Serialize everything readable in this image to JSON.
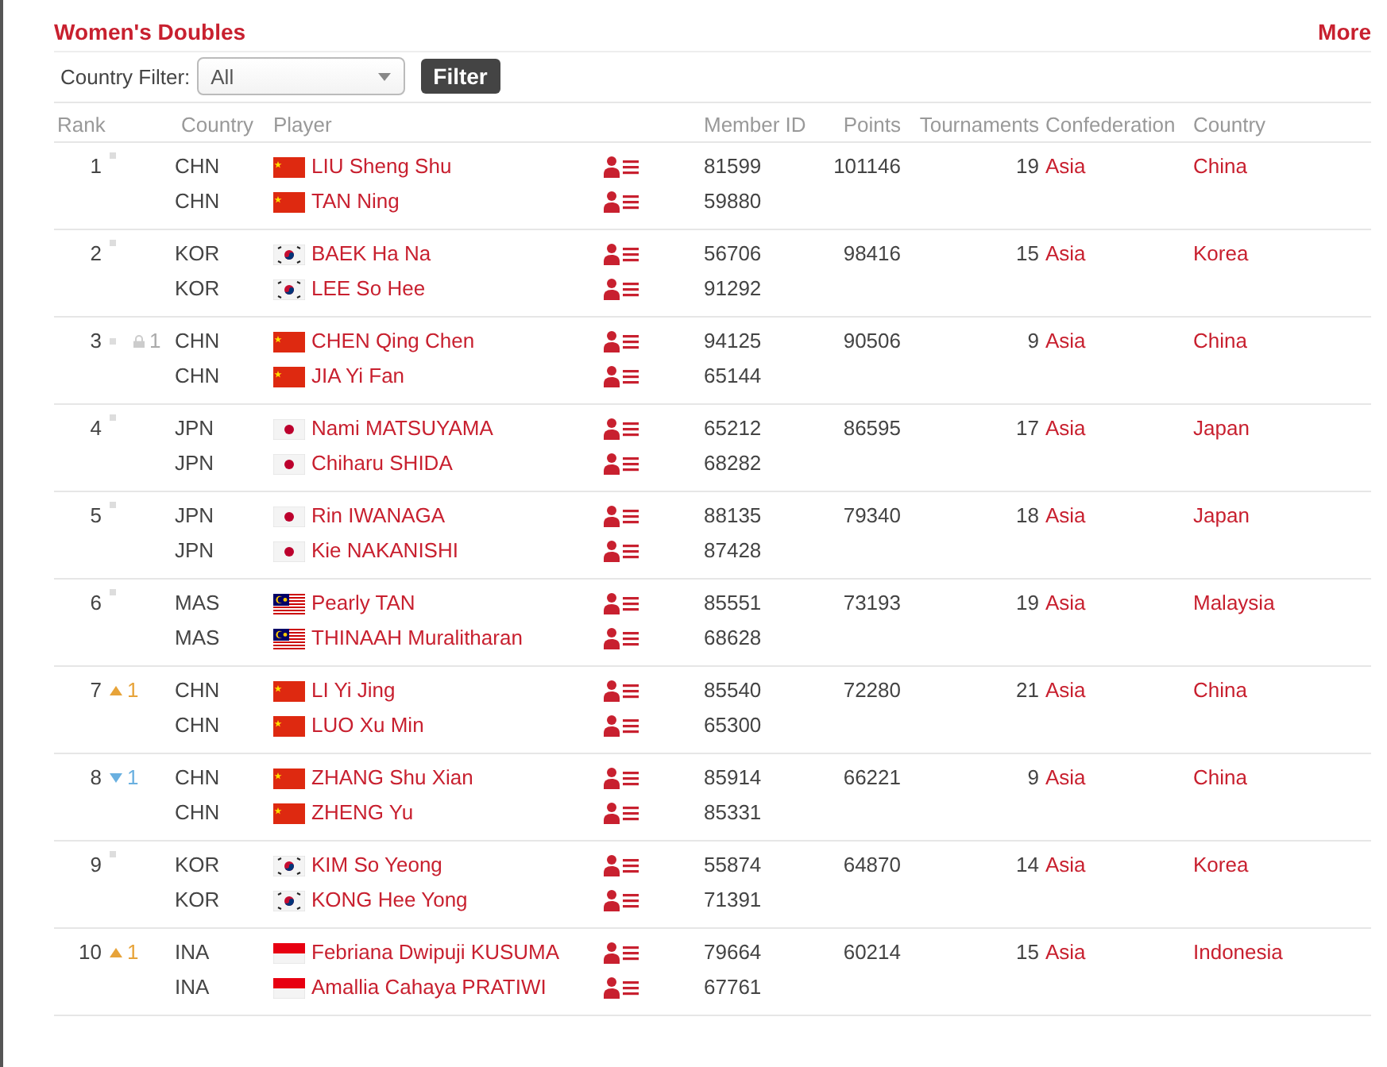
{
  "title": "Women's Doubles",
  "more_link": "More",
  "filter": {
    "label": "Country Filter:",
    "value": "All",
    "button": "Filter"
  },
  "columns": [
    "Rank",
    "Country",
    "Player",
    "Member ID",
    "Points",
    "Tournaments",
    "Confederation",
    "Country"
  ],
  "rows": [
    {
      "rank": "1",
      "trend": {
        "kind": "same"
      },
      "points": "101146",
      "tournaments": "19",
      "confederation": "Asia",
      "country": "China",
      "players": [
        {
          "code": "CHN",
          "kind": "china",
          "name": "LIU Sheng Shu",
          "member_id": "81599"
        },
        {
          "code": "CHN",
          "kind": "china",
          "name": "TAN Ning",
          "member_id": "59880"
        }
      ]
    },
    {
      "rank": "2",
      "trend": {
        "kind": "same"
      },
      "points": "98416",
      "tournaments": "15",
      "confederation": "Asia",
      "country": "Korea",
      "players": [
        {
          "code": "KOR",
          "kind": "korea",
          "name": "BAEK Ha Na",
          "member_id": "56706"
        },
        {
          "code": "KOR",
          "kind": "korea",
          "name": "LEE So Hee",
          "member_id": "91292"
        }
      ]
    },
    {
      "rank": "3",
      "trend": {
        "kind": "locked",
        "change": "1"
      },
      "points": "90506",
      "tournaments": "9",
      "confederation": "Asia",
      "country": "China",
      "players": [
        {
          "code": "CHN",
          "kind": "china",
          "name": "CHEN Qing Chen",
          "member_id": "94125"
        },
        {
          "code": "CHN",
          "kind": "china",
          "name": "JIA Yi Fan",
          "member_id": "65144"
        }
      ]
    },
    {
      "rank": "4",
      "trend": {
        "kind": "same"
      },
      "points": "86595",
      "tournaments": "17",
      "confederation": "Asia",
      "country": "Japan",
      "players": [
        {
          "code": "JPN",
          "kind": "japan",
          "name": "Nami MATSUYAMA",
          "member_id": "65212"
        },
        {
          "code": "JPN",
          "kind": "japan",
          "name": "Chiharu SHIDA",
          "member_id": "68282"
        }
      ]
    },
    {
      "rank": "5",
      "trend": {
        "kind": "same"
      },
      "points": "79340",
      "tournaments": "18",
      "confederation": "Asia",
      "country": "Japan",
      "players": [
        {
          "code": "JPN",
          "kind": "japan",
          "name": "Rin IWANAGA",
          "member_id": "88135"
        },
        {
          "code": "JPN",
          "kind": "japan",
          "name": "Kie NAKANISHI",
          "member_id": "87428"
        }
      ]
    },
    {
      "rank": "6",
      "trend": {
        "kind": "same"
      },
      "points": "73193",
      "tournaments": "19",
      "confederation": "Asia",
      "country": "Malaysia",
      "players": [
        {
          "code": "MAS",
          "kind": "malaysia",
          "name": "Pearly TAN",
          "member_id": "85551"
        },
        {
          "code": "MAS",
          "kind": "malaysia",
          "name": "THINAAH Muralitharan",
          "member_id": "68628"
        }
      ]
    },
    {
      "rank": "7",
      "trend": {
        "kind": "up",
        "change": "1"
      },
      "points": "72280",
      "tournaments": "21",
      "confederation": "Asia",
      "country": "China",
      "players": [
        {
          "code": "CHN",
          "kind": "china",
          "name": "LI Yi Jing",
          "member_id": "85540"
        },
        {
          "code": "CHN",
          "kind": "china",
          "name": "LUO Xu Min",
          "member_id": "65300"
        }
      ]
    },
    {
      "rank": "8",
      "trend": {
        "kind": "down",
        "change": "1"
      },
      "points": "66221",
      "tournaments": "9",
      "confederation": "Asia",
      "country": "China",
      "players": [
        {
          "code": "CHN",
          "kind": "china",
          "name": "ZHANG Shu Xian",
          "member_id": "85914"
        },
        {
          "code": "CHN",
          "kind": "china",
          "name": "ZHENG Yu",
          "member_id": "85331"
        }
      ]
    },
    {
      "rank": "9",
      "trend": {
        "kind": "same"
      },
      "points": "64870",
      "tournaments": "14",
      "confederation": "Asia",
      "country": "Korea",
      "players": [
        {
          "code": "KOR",
          "kind": "korea",
          "name": "KIM So Yeong",
          "member_id": "55874"
        },
        {
          "code": "KOR",
          "kind": "korea",
          "name": "KONG Hee Yong",
          "member_id": "71391"
        }
      ]
    },
    {
      "rank": "10",
      "trend": {
        "kind": "up",
        "change": "1"
      },
      "points": "60214",
      "tournaments": "15",
      "confederation": "Asia",
      "country": "Indonesia",
      "players": [
        {
          "code": "INA",
          "kind": "indonesia",
          "name": "Febriana Dwipuji KUSUMA",
          "member_id": "79664"
        },
        {
          "code": "INA",
          "kind": "indonesia",
          "name": "Amallia Cahaya PRATIWI",
          "member_id": "67761"
        }
      ]
    }
  ]
}
